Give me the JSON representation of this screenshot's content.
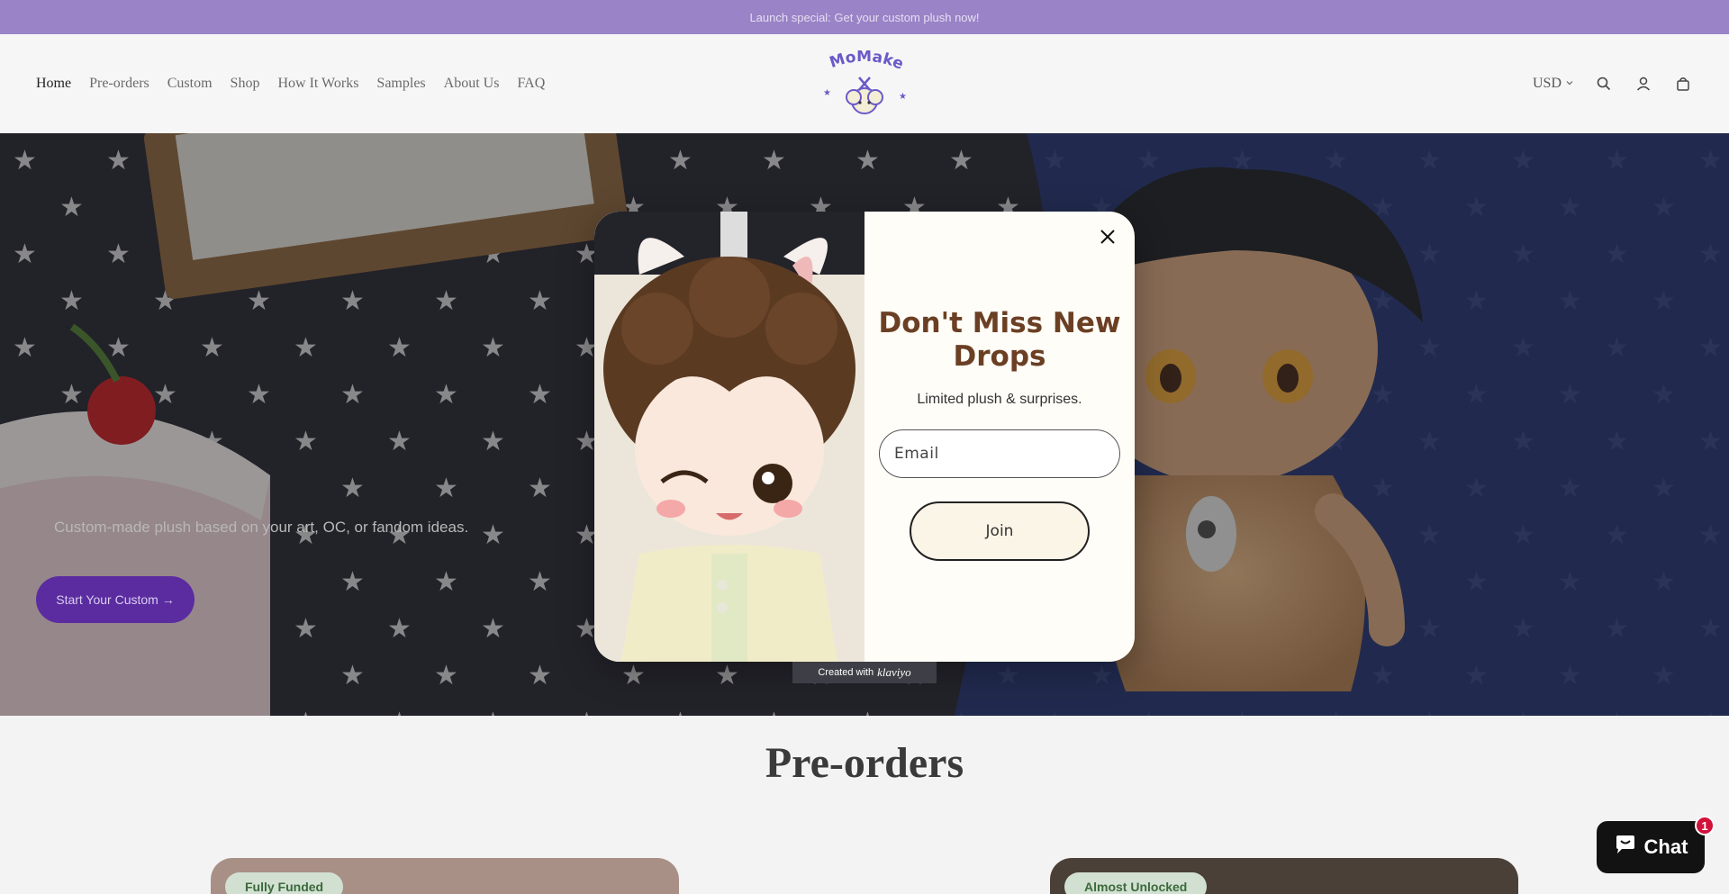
{
  "announcement": "Launch special: Get your custom plush now!",
  "nav": {
    "items": [
      "Home",
      "Pre-orders",
      "Custom",
      "Shop",
      "How It Works",
      "Samples",
      "About Us",
      "FAQ"
    ]
  },
  "header": {
    "logo_alt": "MoMakeIt",
    "currency": "USD",
    "icons": [
      "search-icon",
      "account-icon",
      "cart-icon"
    ]
  },
  "hero": {
    "text": "Custom-made plush based on your art, OC, or fandom ideas.",
    "cta": "Start Your Custom →"
  },
  "section": {
    "title": "Pre-orders",
    "cards": [
      {
        "badge": "Fully Funded"
      },
      {
        "badge": "Almost Unlocked"
      }
    ]
  },
  "modal": {
    "title": "Don't Miss New Drops",
    "subtitle": "Limited plush & surprises.",
    "email_placeholder": "Email",
    "join_label": "Join",
    "created_with": "Created with",
    "brand": "klaviyo"
  },
  "chat": {
    "label": "Chat",
    "badge": "1"
  },
  "colors": {
    "announce_bg": "#9a83c6",
    "cta_bg": "#5b2ca0",
    "modal_title": "#6b3f24",
    "badge_bg": "#d2e0d2"
  }
}
